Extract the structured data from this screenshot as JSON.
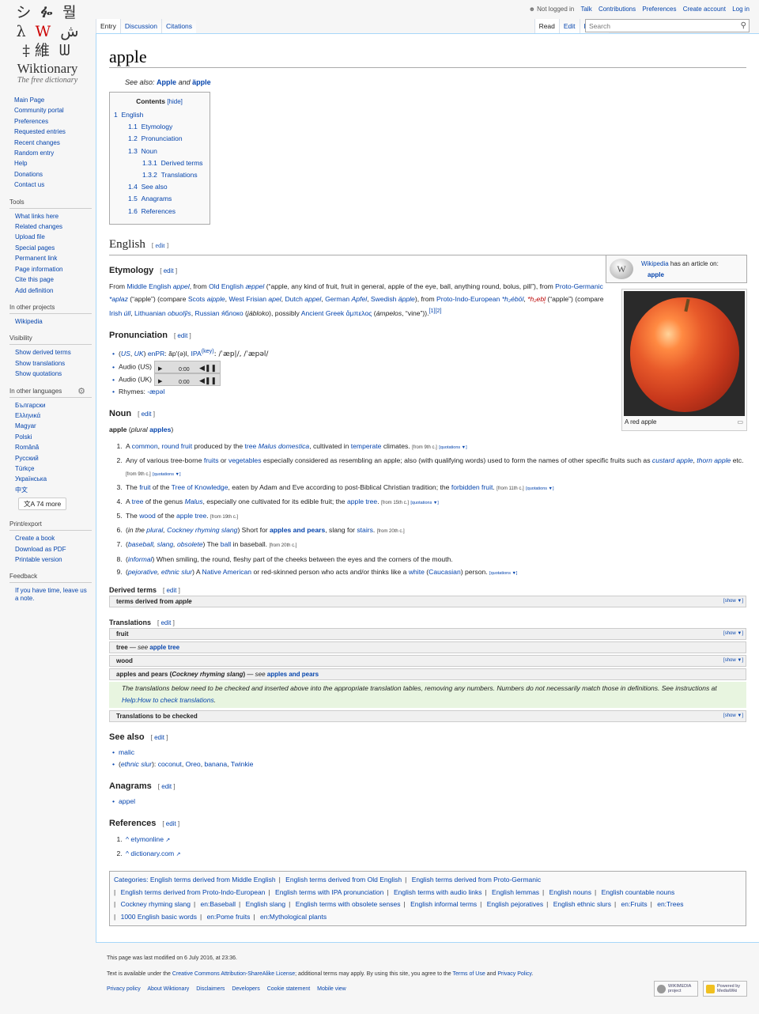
{
  "logo": {
    "wordmark": "Wiktionary",
    "tagline": "The free dictionary"
  },
  "personal": {
    "not_logged_in": "Not logged in",
    "links": [
      "Talk",
      "Contributions",
      "Preferences",
      "Create account",
      "Log in"
    ]
  },
  "tabs": {
    "left": [
      "Entry",
      "Discussion",
      "Citations"
    ],
    "right": [
      "Read",
      "Edit",
      "History"
    ]
  },
  "search": {
    "placeholder": "Search"
  },
  "sidebar": {
    "navigation": [
      "Main Page",
      "Community portal",
      "Preferences",
      "Requested entries",
      "Recent changes",
      "Random entry",
      "Help",
      "Donations",
      "Contact us"
    ],
    "tools": {
      "title": "Tools",
      "items": [
        "What links here",
        "Related changes",
        "Upload file",
        "Special pages",
        "Permanent link",
        "Page information",
        "Cite this page",
        "Add definition"
      ]
    },
    "projects": {
      "title": "In other projects",
      "items": [
        "Wikipedia"
      ]
    },
    "visibility": {
      "title": "Visibility",
      "items": [
        "Show derived terms",
        "Show translations",
        "Show quotations"
      ]
    },
    "languages": {
      "title": "In other languages",
      "items": [
        "Български",
        "Ελληνικά",
        "Magyar",
        "Polski",
        "Română",
        "Русский",
        "Türkçe",
        "Українська",
        "中文"
      ],
      "more": "74 more"
    },
    "print": {
      "title": "Print/export",
      "items": [
        "Create a book",
        "Download as PDF",
        "Printable version"
      ]
    },
    "feedback": {
      "title": "Feedback",
      "text": "If you have time, leave us a note."
    }
  },
  "page": {
    "title": "apple",
    "see_also_label": "See also:",
    "see_also_1": "Apple",
    "see_also_and": "and",
    "see_also_2": "äpple",
    "toc": {
      "title": "Contents",
      "hide": "[hide]",
      "entries": [
        {
          "num": "1",
          "text": "English"
        },
        {
          "num": "1.1",
          "text": "Etymology"
        },
        {
          "num": "1.2",
          "text": "Pronunciation"
        },
        {
          "num": "1.3",
          "text": "Noun"
        },
        {
          "num": "1.3.1",
          "text": "Derived terms"
        },
        {
          "num": "1.3.2",
          "text": "Translations"
        },
        {
          "num": "1.4",
          "text": "See also"
        },
        {
          "num": "1.5",
          "text": "Anagrams"
        },
        {
          "num": "1.6",
          "text": "References"
        }
      ]
    },
    "edit_label": "edit",
    "h_english": "English",
    "h_etymology": "Etymology",
    "h_pronunciation": "Pronunciation",
    "h_noun": "Noun",
    "h_derived": "Derived terms",
    "h_translations": "Translations",
    "h_seealso": "See also",
    "h_anagrams": "Anagrams",
    "h_references": "References",
    "wikipedia_box": {
      "link": "Wikipedia",
      "text": "has an article on:",
      "article": "apple"
    },
    "image_caption": "A red apple",
    "pronunciation": {
      "ipa_line_prefix": "(",
      "us": "US",
      "uk": "UK",
      "enpr": "enPR",
      "enpr_value": ": ăp′(ə)l,",
      "ipa": "IPA",
      "key": "(key)",
      "ipa_value": ": /ˈæp|/, /ˈæpəl/",
      "audio_us": "Audio (US)",
      "audio_uk": "Audio (UK)",
      "audio_time": "0:00",
      "rhymes_label": "Rhymes:",
      "rhymes_value": "-æpəl"
    },
    "headword": "apple",
    "plural_label": "plural",
    "plural_value": "apples",
    "show_label": "[show ▼]",
    "derived_box": "terms derived from",
    "derived_word": "apple",
    "trans_boxes": {
      "fruit": "fruit",
      "tree": "tree",
      "tree_see": "— see",
      "tree_link": "apple tree",
      "wood": "wood",
      "aap": "apples and pears",
      "aap_note": "Cockney rhyming slang",
      "aap_see": "— see",
      "aap_link": "apples and pears",
      "check": "Translations to be checked"
    },
    "trans_note_1": "The translations below need to be checked and inserted above into the appropriate translation tables, removing any numbers. Numbers do not necessarily match those in definitions. See instructions at",
    "trans_note_link": "Help:How to check translations",
    "see_also_items": [
      "malic"
    ],
    "see_also_slur_label": "ethnic slur",
    "see_also_slur_items": [
      "coconut",
      "Oreo",
      "banana",
      "Twinkie"
    ],
    "anagrams": [
      "appel"
    ],
    "references": [
      "^ etymonline",
      "^ dictionary.com"
    ]
  },
  "categories": {
    "label": "Categories:",
    "items": [
      "English terms derived from Middle English",
      "English terms derived from Old English",
      "English terms derived from Proto-Germanic",
      "English terms derived from Proto-Indo-European",
      "English terms with IPA pronunciation",
      "English terms with audio links",
      "English lemmas",
      "English nouns",
      "English countable nouns",
      "Cockney rhyming slang",
      "en:Baseball",
      "English slang",
      "English terms with obsolete senses",
      "English informal terms",
      "English pejoratives",
      "English ethnic slurs",
      "en:Fruits",
      "en:Trees",
      "1000 English basic words",
      "en:Pome fruits",
      "en:Mythological plants"
    ]
  },
  "footer": {
    "modified": "This page was last modified on 6 July 2016, at 23:36.",
    "license_prefix": "Text is available under the",
    "license_link": "Creative Commons Attribution-ShareAlike License",
    "license_mid": "; additional terms may apply. By using this site, you agree to the",
    "terms_link": "Terms of Use",
    "and": "and",
    "privacy_link": "Privacy Policy",
    "places": [
      "Privacy policy",
      "About Wiktionary",
      "Disclaimers",
      "Developers",
      "Cookie statement",
      "Mobile view"
    ],
    "badge_wikimedia": "WIKIMEDIA project",
    "badge_mediawiki": "Powered by MediaWiki"
  },
  "colors": {
    "link": "#0645ad",
    "redlink": "#ba0000",
    "note_bg": "#e8f5e0"
  }
}
